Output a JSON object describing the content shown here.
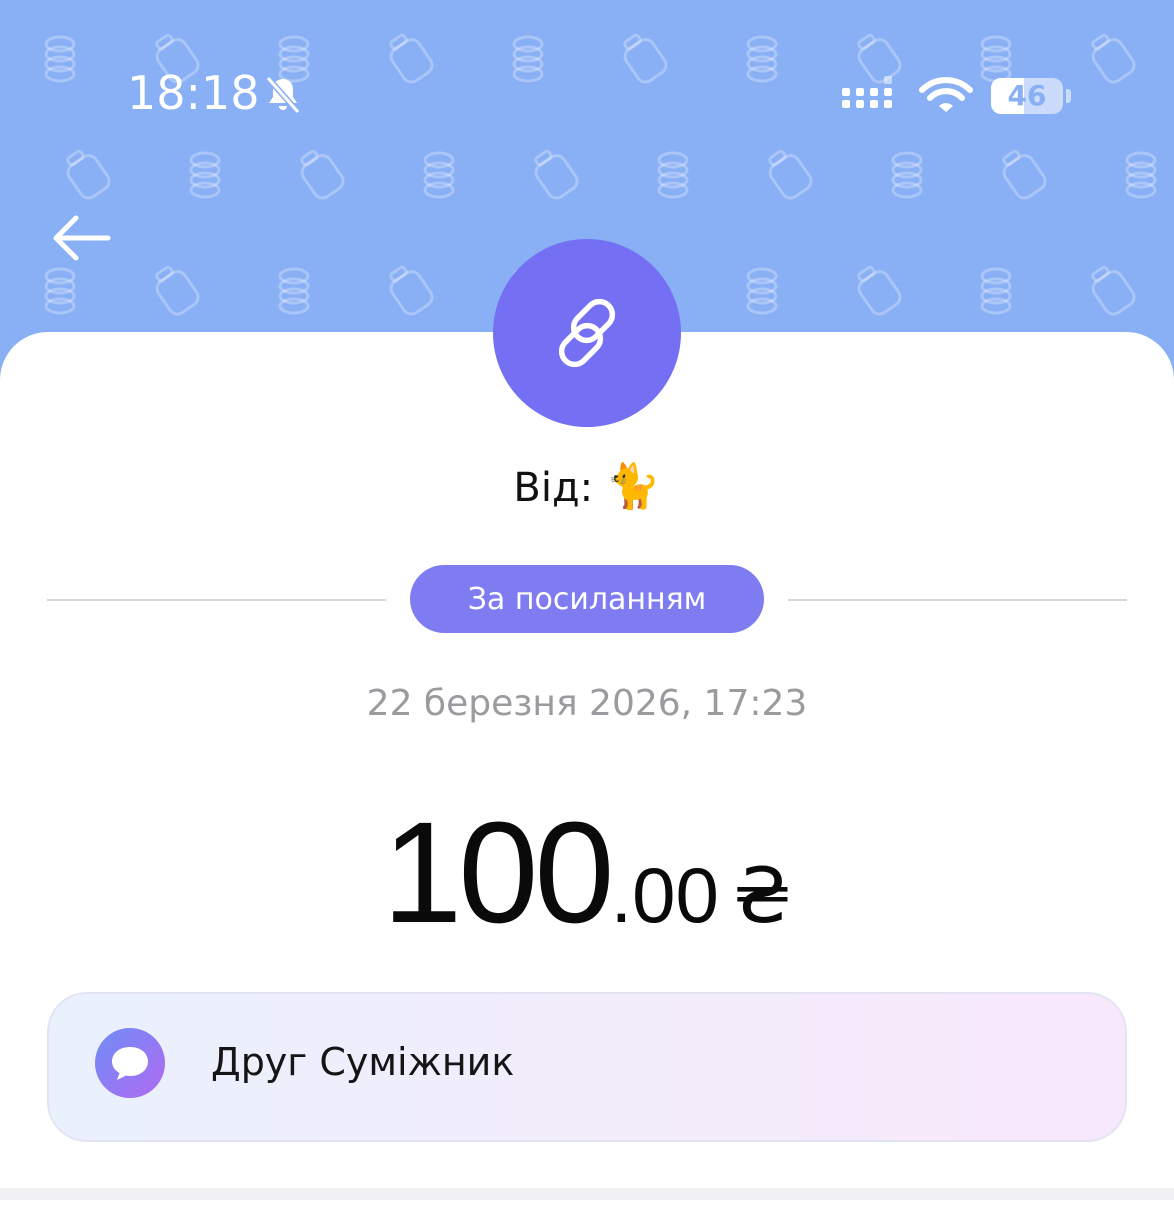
{
  "status_bar": {
    "time": "18:18",
    "silent_icon": "bell-slash-icon",
    "signal_icon": "cellular-signal-icon",
    "wifi_icon": "wifi-icon",
    "battery_percent": "46",
    "battery_level": 0.46
  },
  "header": {
    "back_icon": "arrow-left-icon",
    "pattern_icons": [
      "coin-stack-icon",
      "jar-icon"
    ],
    "background_color": "#89aff5"
  },
  "transaction": {
    "type_icon": "link-icon",
    "from_label": "Від:",
    "from_emoji": "🐈",
    "method_label": "За посиланням",
    "date": "22 березня 2026, 17:23",
    "amount_integer": "100",
    "amount_decimal": ".00",
    "currency": "₴",
    "accent_color": "#746ff3"
  },
  "comment": {
    "icon": "message-bubble-icon",
    "text": "Друг Суміжник"
  }
}
